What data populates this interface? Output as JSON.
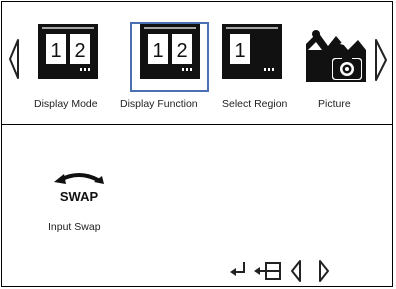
{
  "menu": {
    "items": [
      {
        "label": "Display Mode",
        "icon": "display-mode-icon",
        "digits": [
          "1",
          "2"
        ]
      },
      {
        "label": "Display Function",
        "icon": "display-function-icon",
        "digits": [
          "1",
          "2"
        ],
        "selected": true
      },
      {
        "label": "Select Region",
        "icon": "select-region-icon",
        "digits": [
          "1"
        ]
      },
      {
        "label": "Picture",
        "icon": "picture-icon"
      }
    ]
  },
  "function_panel": {
    "swap_text": "SWAP",
    "swap_label": "Input Swap"
  },
  "footer": {
    "icons": [
      "enter-icon",
      "exit-icon",
      "left-icon",
      "right-icon"
    ]
  },
  "colors": {
    "selection": "#4a6fb5",
    "icon": "#111111"
  }
}
